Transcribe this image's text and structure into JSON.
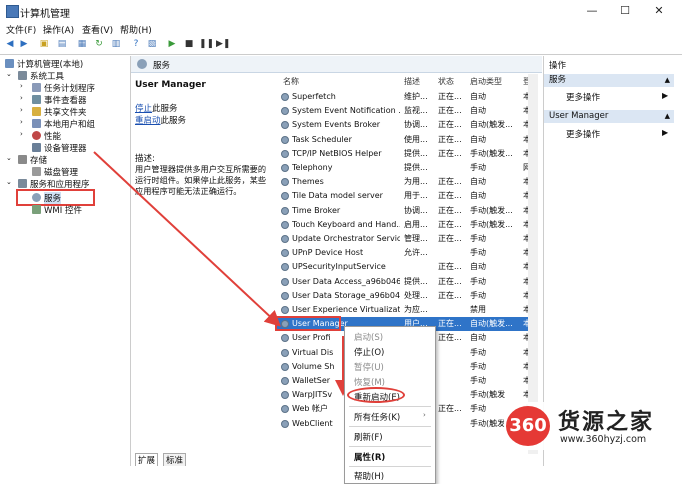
{
  "window": {
    "title": "计算机管理",
    "controls": {
      "minimize": "—",
      "maximize": "☐",
      "close": "✕"
    }
  },
  "menu": [
    "文件(F)",
    "操作(A)",
    "查看(V)",
    "帮助(H)"
  ],
  "tree": {
    "root": "计算机管理(本地)",
    "system_tools": "系统工具",
    "task_scheduler": "任务计划程序",
    "event_viewer": "事件查看器",
    "shared_folders": "共享文件夹",
    "local_users": "本地用户和组",
    "performance": "性能",
    "device_manager": "设备管理器",
    "storage": "存储",
    "disk_management": "磁盘管理",
    "services_apps": "服务和应用程序",
    "services": "服务",
    "wmi": "WMI 控件"
  },
  "middle": {
    "header": "服务",
    "selected_service": "User Manager",
    "stop_link": "停止",
    "stop_suffix": "此服务",
    "restart_link": "重启动",
    "restart_suffix": "此服务",
    "desc_label": "描述:",
    "desc_text": "用户管理器提供多用户交互所需要的运行时组件。如果停止此服务，某些应用程序可能无法正确运行。"
  },
  "columns": {
    "name": "名称",
    "desc": "描述",
    "status": "状态",
    "startup": "启动类型",
    "logon": "登"
  },
  "services": [
    {
      "name": "Superfetch",
      "desc": "维护...",
      "status": "正在...",
      "startup": "自动",
      "logon": "本"
    },
    {
      "name": "System Event Notification ...",
      "desc": "监视...",
      "status": "正在...",
      "startup": "自动",
      "logon": "本"
    },
    {
      "name": "System Events Broker",
      "desc": "协调...",
      "status": "正在...",
      "startup": "自动(触发...",
      "logon": "本"
    },
    {
      "name": "Task Scheduler",
      "desc": "使用...",
      "status": "正在...",
      "startup": "自动",
      "logon": "本"
    },
    {
      "name": "TCP/IP NetBIOS Helper",
      "desc": "提供...",
      "status": "正在...",
      "startup": "手动(触发...",
      "logon": "本"
    },
    {
      "name": "Telephony",
      "desc": "提供...",
      "status": "",
      "startup": "手动",
      "logon": "网"
    },
    {
      "name": "Themes",
      "desc": "为用...",
      "status": "正在...",
      "startup": "自动",
      "logon": "本"
    },
    {
      "name": "Tile Data model server",
      "desc": "用于...",
      "status": "正在...",
      "startup": "自动",
      "logon": "本"
    },
    {
      "name": "Time Broker",
      "desc": "协调...",
      "status": "正在...",
      "startup": "手动(触发...",
      "logon": "本"
    },
    {
      "name": "Touch Keyboard and Hand...",
      "desc": "启用...",
      "status": "正在...",
      "startup": "手动(触发...",
      "logon": "本"
    },
    {
      "name": "Update Orchestrator Service",
      "desc": "管理...",
      "status": "正在...",
      "startup": "手动",
      "logon": "本"
    },
    {
      "name": "UPnP Device Host",
      "desc": "允许...",
      "status": "",
      "startup": "手动",
      "logon": "本"
    },
    {
      "name": "UPSecurityInputService",
      "desc": "",
      "status": "正在...",
      "startup": "自动",
      "logon": "本"
    },
    {
      "name": "User Data Access_a96b046",
      "desc": "提供...",
      "status": "正在...",
      "startup": "手动",
      "logon": "本"
    },
    {
      "name": "User Data Storage_a96b046",
      "desc": "处理...",
      "status": "正在...",
      "startup": "手动",
      "logon": "本"
    },
    {
      "name": "User Experience Virtualizat...",
      "desc": "为应...",
      "status": "",
      "startup": "禁用",
      "logon": "本"
    },
    {
      "name": "User Manager",
      "desc": "用户...",
      "status": "正在...",
      "startup": "自动(触发...",
      "logon": "本"
    },
    {
      "name": "User Profi",
      "desc": "",
      "status": "正在...",
      "startup": "自动",
      "logon": "本"
    },
    {
      "name": "Virtual Dis",
      "desc": "",
      "status": "",
      "startup": "手动",
      "logon": "本"
    },
    {
      "name": "Volume Sh",
      "desc": "",
      "status": "",
      "startup": "手动",
      "logon": "本"
    },
    {
      "name": "WalletSer",
      "desc": "",
      "status": "",
      "startup": "手动",
      "logon": "本"
    },
    {
      "name": "WarpJITSv",
      "desc": "",
      "status": "",
      "startup": "手动(触发",
      "logon": "本"
    },
    {
      "name": "Web 帐户",
      "desc": "",
      "status": "正在...",
      "startup": "手动",
      "logon": "本"
    },
    {
      "name": "WebClient",
      "desc": "",
      "status": "",
      "startup": "手动(触发",
      "logon": "本"
    }
  ],
  "tabs": {
    "extended": "扩展",
    "standard": "标准"
  },
  "actions": {
    "title": "操作",
    "group1": "服务",
    "more1": "更多操作",
    "group2": "User Manager",
    "more2": "更多操作"
  },
  "context_menu": {
    "start": "启动(S)",
    "stop": "停止(O)",
    "pause": "暂停(U)",
    "resume": "恢复(M)",
    "restart": "重新启动(E)",
    "all_tasks": "所有任务(K)",
    "refresh": "刷新(F)",
    "properties": "属性(R)",
    "help": "帮助(H)"
  },
  "watermark": {
    "badge": "360",
    "name": "货源之家",
    "url": "www.360hyzj.com"
  },
  "colors": {
    "selection": "#2f74c8",
    "annotation": "#e0403a",
    "header_bg": "#dbe6f3"
  }
}
